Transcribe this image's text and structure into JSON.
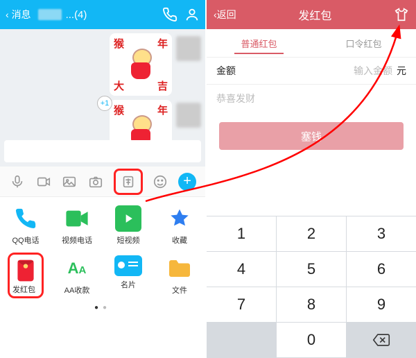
{
  "left": {
    "header": {
      "back": "消息",
      "count": "...(4)"
    },
    "sticker_chars": {
      "tl": "猴",
      "tr": "年",
      "bl": "大",
      "br": "吉"
    },
    "plus1": "+1",
    "grid": [
      {
        "label": "QQ电话"
      },
      {
        "label": "视频电话"
      },
      {
        "label": "短视频"
      },
      {
        "label": "收藏"
      },
      {
        "label": "发红包"
      },
      {
        "label": "AA收款"
      },
      {
        "label": "名片"
      },
      {
        "label": "文件"
      }
    ]
  },
  "right": {
    "header": {
      "back": "返回",
      "title": "发红包"
    },
    "tabs": {
      "normal": "普通红包",
      "code": "口令红包"
    },
    "amount": {
      "label": "金额",
      "placeholder": "输入金额",
      "unit": "元"
    },
    "message_placeholder": "恭喜发财",
    "button": "塞钱",
    "keypad": [
      "1",
      "2",
      "3",
      "4",
      "5",
      "6",
      "7",
      "8",
      "9",
      "",
      "0",
      "⌫"
    ]
  }
}
